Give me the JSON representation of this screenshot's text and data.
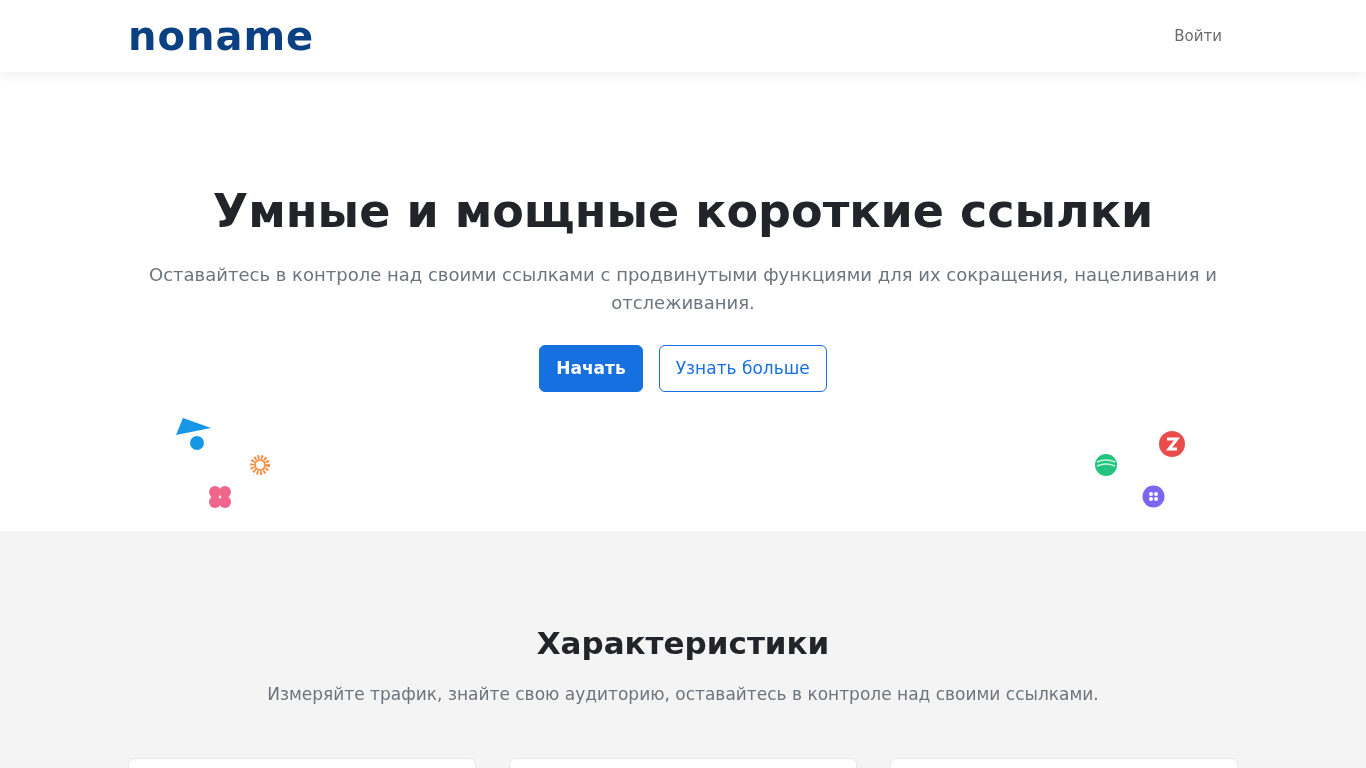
{
  "navbar": {
    "logo": "noname",
    "login": "Войти"
  },
  "hero": {
    "title": "Умные и мощные короткие ссылки",
    "subtitle": "Оставайтесь в контроле над своими ссылками с продвинутыми функциями для их сокращения, нацеливания и отслеживания.",
    "buttons": [
      {
        "label": "Начать",
        "kind": "primary"
      },
      {
        "label": "Узнать больше",
        "kind": "outline"
      }
    ]
  },
  "features": {
    "title": "Характеристики",
    "subtitle": "Измеряйте трафик, знайте свою аудиторию, оставайтесь в контроле над своими ссылками."
  }
}
